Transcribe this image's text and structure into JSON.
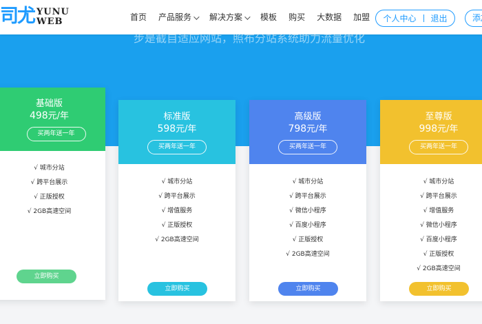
{
  "header": {
    "logo_cn": "司尤",
    "logo_en_line1": "YUNU",
    "logo_en_line2": "WEB",
    "nav": [
      {
        "label": "首页",
        "has_dropdown": false
      },
      {
        "label": "产品服务",
        "has_dropdown": true
      },
      {
        "label": "解决方案",
        "has_dropdown": true
      },
      {
        "label": "模板",
        "has_dropdown": false
      },
      {
        "label": "购买",
        "has_dropdown": false
      },
      {
        "label": "大数据",
        "has_dropdown": false
      },
      {
        "label": "加盟",
        "has_dropdown": false
      }
    ],
    "user_center": "个人中心",
    "logout": "退出",
    "side_tab": "添加"
  },
  "banner": {
    "text": "步是截自适应网站，照布分站系统助力流量优化"
  },
  "colors": {
    "banner": "#1aa0ee",
    "basic": "#2fcc73",
    "standard": "#28c2e0",
    "advanced": "#4f84ee",
    "premium": "#f2c12e"
  },
  "plans": [
    {
      "name": "基础版",
      "price": "498",
      "unit": "元/年",
      "promo": "买两年送一年",
      "features": [
        "√ 城市分站",
        "√ 跨平台展示",
        "√ 正版授权",
        "√ 2GB高速空间"
      ],
      "buy_label": "立即购买"
    },
    {
      "name": "标准版",
      "price": "598",
      "unit": "元/年",
      "promo": "买两年送一年",
      "features": [
        "√ 城市分站",
        "√ 跨平台展示",
        "√ 增值服务",
        "√ 正版授权",
        "√ 2GB高速空间"
      ],
      "buy_label": "立即购买"
    },
    {
      "name": "高级版",
      "price": "798",
      "unit": "元/年",
      "promo": "买两年送一年",
      "features": [
        "√ 城市分站",
        "√ 跨平台展示",
        "√ 微信小程序",
        "√ 百度小程序",
        "√ 正版授权",
        "√ 2GB高速空间"
      ],
      "buy_label": "立即购买"
    },
    {
      "name": "至尊版",
      "price": "998",
      "unit": "元/年",
      "promo": "买两年送一年",
      "features": [
        "√ 城市分站",
        "√ 跨平台展示",
        "√ 增值服务",
        "√ 微信小程序",
        "√ 百度小程序",
        "√ 正版授权",
        "√ 2GB高速空间"
      ],
      "buy_label": "立即购买"
    }
  ]
}
